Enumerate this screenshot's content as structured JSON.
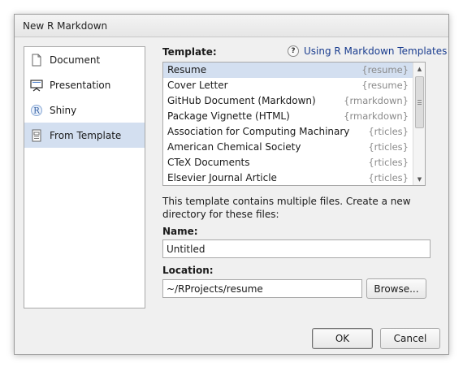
{
  "window": {
    "title": "New R Markdown"
  },
  "sidebar": {
    "items": [
      {
        "label": "Document",
        "icon": "document-icon"
      },
      {
        "label": "Presentation",
        "icon": "presentation-icon"
      },
      {
        "label": "Shiny",
        "icon": "shiny-icon"
      },
      {
        "label": "From Template",
        "icon": "template-icon",
        "selected": true
      }
    ]
  },
  "template_section": {
    "label": "Template:",
    "help_link": "Using R Markdown Templates",
    "items": [
      {
        "name": "Resume",
        "package": "{resume}",
        "selected": true
      },
      {
        "name": "Cover Letter",
        "package": "{resume}"
      },
      {
        "name": "GitHub Document (Markdown)",
        "package": "{rmarkdown}"
      },
      {
        "name": "Package Vignette (HTML)",
        "package": "{rmarkdown}"
      },
      {
        "name": "Association for Computing Machinary",
        "package": "{rticles}"
      },
      {
        "name": "American Chemical Society",
        "package": "{rticles}"
      },
      {
        "name": "CTeX Documents",
        "package": "{rticles}"
      },
      {
        "name": "Elsevier Journal Article",
        "package": "{rticles}"
      }
    ]
  },
  "description": "This template contains multiple files. Create a new directory for these files:",
  "name_field": {
    "label": "Name:",
    "value": "Untitled"
  },
  "location_field": {
    "label": "Location:",
    "value": "~/RProjects/resume",
    "browse_label": "Browse..."
  },
  "buttons": {
    "ok": "OK",
    "cancel": "Cancel"
  }
}
